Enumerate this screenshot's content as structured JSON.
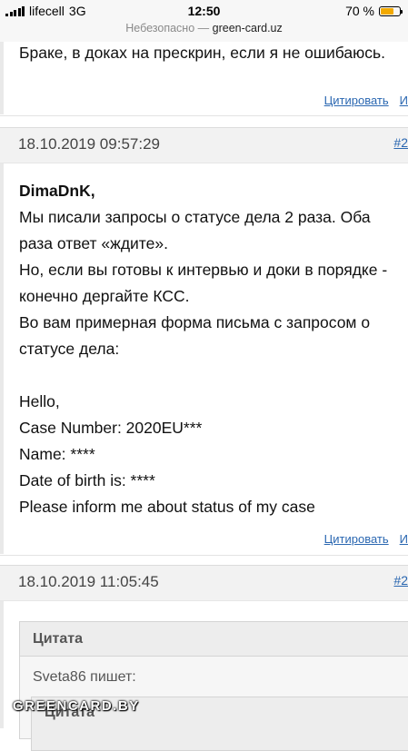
{
  "status_bar": {
    "carrier": "lifecell",
    "network": "3G",
    "time": "12:50",
    "battery_percent": "70 %",
    "battery_level": 0.7
  },
  "url_bar": {
    "security": "Небезопасно —",
    "host": "green-card.uz"
  },
  "top_post": {
    "tail_text": "Браке, в доках на прескрин, если я не ошибаюсь.",
    "quote_link": "Цитировать",
    "extra_link": "И"
  },
  "post1": {
    "date": "18.10.2019 09:57:29",
    "number": "#2",
    "author": "DimaDnK,",
    "lines": [
      "Мы писали запросы о статусе дела 2 раза. Оба",
      "раза ответ «ждите».",
      "Но, если вы готовы к интервью и доки в порядке -",
      "конечно дергайте КСС.",
      "Во вам примерная форма письма с запросом о",
      "статусе дела:",
      "",
      "Hello,",
      "Case Number: 2020EU***",
      "Name: ****",
      "Date of birth is: ****",
      "Please inform me about status of my case"
    ],
    "quote_link": "Цитировать",
    "extra_link": "И"
  },
  "post2": {
    "date": "18.10.2019 11:05:45",
    "number": "#2",
    "quote_title": "Цитата",
    "quote_author": "Sveta86 пишет:",
    "inner_quote_title": "Цитата"
  },
  "watermark": "GREENCARD.BY"
}
